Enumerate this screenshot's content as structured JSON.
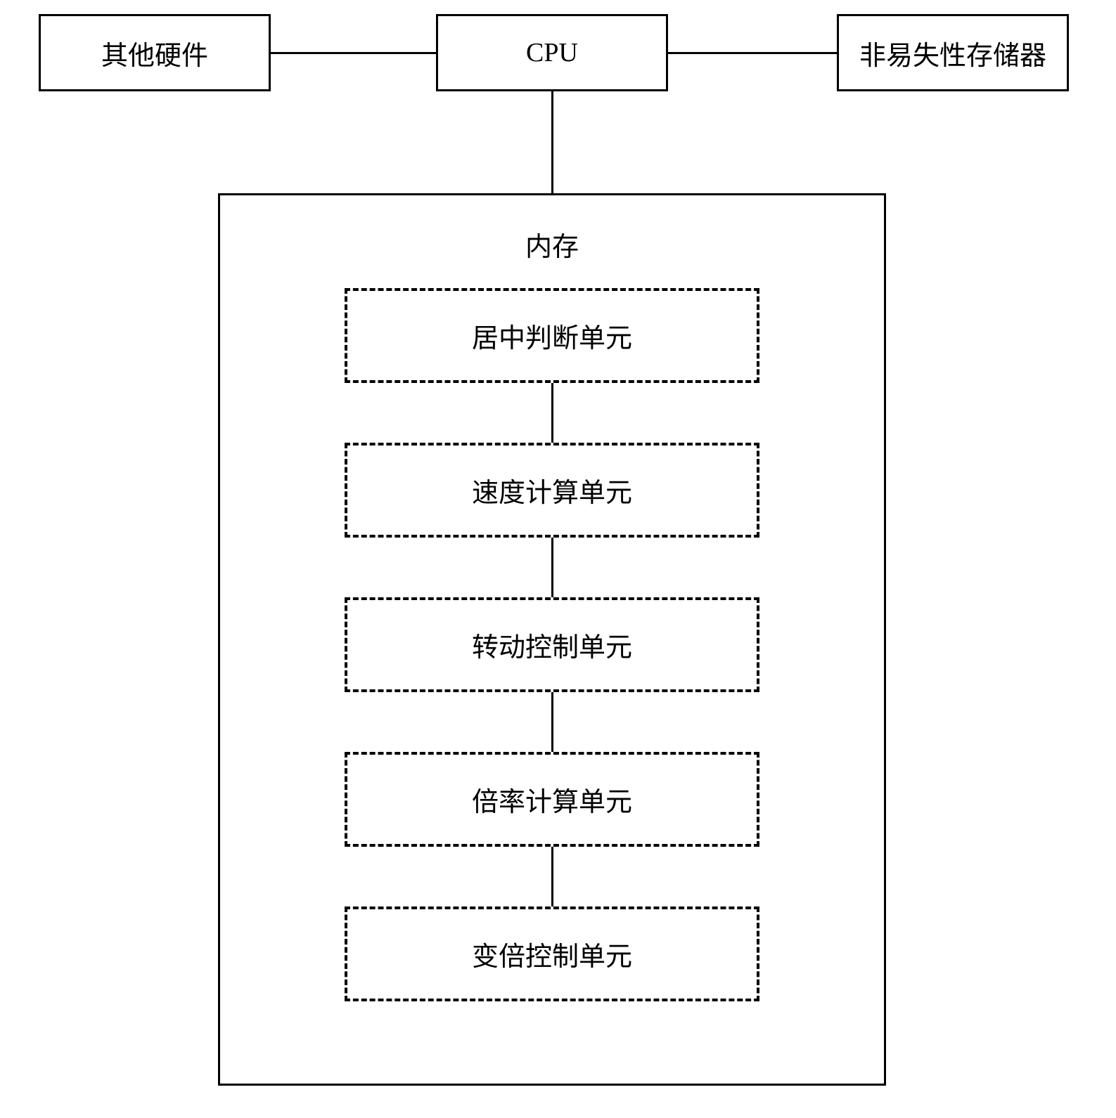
{
  "top_row": {
    "other_hardware": "其他硬件",
    "cpu": "CPU",
    "nv_storage": "非易失性存储器"
  },
  "memory": {
    "label": "内存",
    "units": {
      "center_judgment": "居中判断单元",
      "speed_calc": "速度计算单元",
      "rotation_control": "转动控制单元",
      "magnification_calc": "倍率计算单元",
      "zoom_control": "变倍控制单元"
    }
  }
}
